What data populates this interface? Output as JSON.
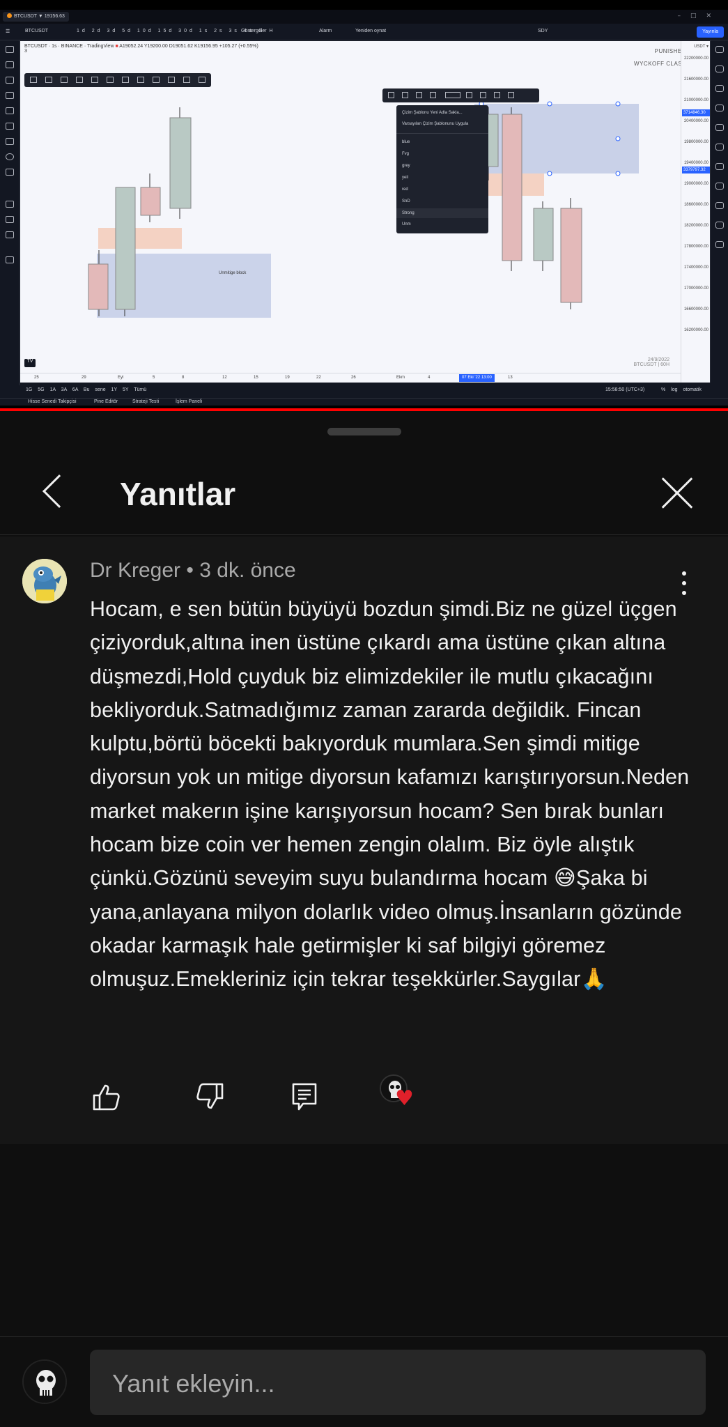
{
  "video": {
    "tab_title": "BTCUSDT ▼ 19156.63",
    "toolbar": {
      "symbol": "BTCUSDT",
      "timeframes": [
        "1d",
        "2d",
        "3d",
        "5d",
        "10d",
        "15d",
        "30d",
        "1s",
        "2s",
        "3s",
        "4s",
        "G",
        "H"
      ],
      "indicators": "Göstergeler",
      "alarm": "Alarm",
      "replay": "Yeniden oynat",
      "layout": "SDY",
      "publish": "Yayınla"
    },
    "legend": {
      "line": "BTCUSDT · 1s · BINANCE · TradingView",
      "ohlc": "A19052.24  Y19200.00  D19051.62  K19156.95  +105.27 (+0.55%)",
      "volume": "3"
    },
    "watermark": {
      "line1": "PUNISHER",
      "line2": "WYCKOFF CLASS"
    },
    "context_menu": {
      "items": [
        "Çizim Şablonu Yeni Adla Sakla...",
        "Varsayılan Çizim Şablonunu Uygula"
      ],
      "templates": [
        "blue",
        "Fvg",
        "grey",
        "yeil",
        "red",
        "SnD",
        "Strong",
        "Unm"
      ]
    },
    "chart_annotation": "Unmitige block",
    "price_labels": [
      "22200000.00",
      "21600000.00",
      "21000000.00",
      "20400000.00",
      "19800000.00",
      "19400000.00",
      "19000000.00",
      "18600000.00",
      "18200000.00",
      "17800000.00",
      "17400000.00",
      "17000000.00",
      "16600000.00",
      "16200000.00"
    ],
    "price_tags": [
      "3714846.30",
      "3379797.32"
    ],
    "price_axis_top": "USDT ▾",
    "time_labels": [
      "25",
      "29",
      "Eyl",
      "5",
      "8",
      "12",
      "15",
      "19",
      "22",
      "26",
      "Ekm",
      "4",
      "11",
      "13"
    ],
    "time_tag": "07 Eki '22  13:00",
    "date_watermark": {
      "line1": "24/9/2022",
      "line2": "BTCUSDT | 60H"
    },
    "bottom_ranges": [
      "1G",
      "5G",
      "1A",
      "3A",
      "6A",
      "Bu sene",
      "1Y",
      "5Y",
      "Tümü"
    ],
    "bottom_right": "15:58:50 (UTC+3)",
    "bottom_right_opts": [
      "%",
      "log",
      "otomatik"
    ],
    "panels": [
      "Hisse Senedi Takipçisi",
      "Pine Editör",
      "Strateji Testi",
      "İşlem Paneli"
    ]
  },
  "replies": {
    "title": "Yanıtlar",
    "comment": {
      "author": "Dr Kreger",
      "time": "3 dk. önce",
      "text": "Hocam, e sen bütün büyüyü bozdun şimdi.Biz ne güzel üçgen çiziyorduk,altına inen üstüne çıkardı ama üstüne çıkan altına düşmezdi,Hold çuyduk biz elimizdekiler ile mutlu çıkacağını bekliyorduk.Satmadığımız zaman zararda değildik. Fincan kulptu,börtü böcekti bakıyorduk mumlara.Sen şimdi mitige diyorsun yok un mitige diyorsun kafamızı karıştırıyorsun.Neden market makerın işine karışıyorsun hocam? Sen bırak bunları hocam bize coin ver hemen zengin olalım. Biz öyle alıştık çünkü.Gözünü seveyim suyu bulandırma hocam 😅Şaka bi yana,anlayana milyon dolarlık video olmuş.İnsanların gözünde okadar karmaşık hale getirmişler ki saf bilgiyi göremez olmuşuz.Emekleriniz için tekrar teşekkürler.Saygılar🙏"
    },
    "reply_placeholder": "Yanıt ekleyin..."
  }
}
